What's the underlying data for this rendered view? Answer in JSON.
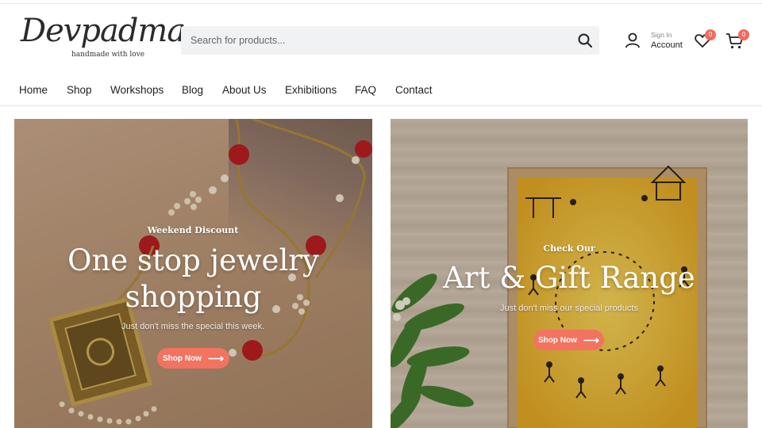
{
  "brand": {
    "name": "Devpadma",
    "tagline": "handmade with love"
  },
  "search": {
    "placeholder": "Search for products..."
  },
  "account": {
    "small_label": "Sign In",
    "label": "Account"
  },
  "wishlist": {
    "count": "0"
  },
  "cart": {
    "count": "0"
  },
  "nav": {
    "items": [
      "Home",
      "Shop",
      "Workshops",
      "Blog",
      "About Us",
      "Exhibitions",
      "FAQ",
      "Contact"
    ]
  },
  "banners": [
    {
      "pre": "Weekend Discount",
      "title_line1": "One stop jewelry",
      "title_line2": "shopping",
      "subtitle": "Just don't miss the special this week.",
      "button": "Shop Now"
    },
    {
      "pre": "Check Our",
      "title_line1": "Art & Gift Range",
      "subtitle": "Just don't miss our special products",
      "button": "Shop Now"
    }
  ],
  "colors": {
    "accent": "#f2735f",
    "badge": "#f26b5b",
    "search_bg": "#f1f2f4"
  },
  "icons": {
    "search": "search-icon",
    "user": "user-icon",
    "wishlist": "heart-icon",
    "cart": "cart-icon",
    "arrow": "arrow-right-icon"
  }
}
